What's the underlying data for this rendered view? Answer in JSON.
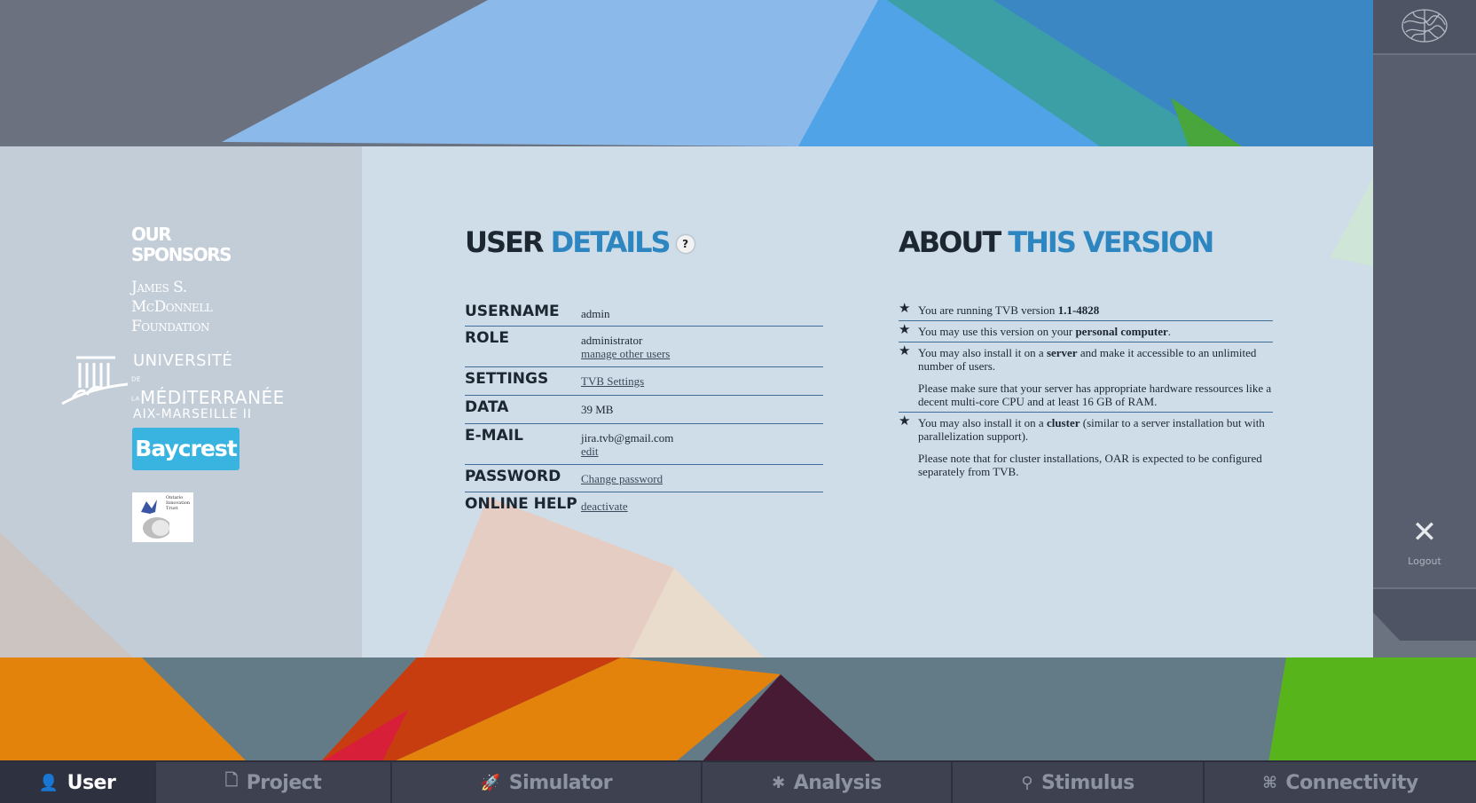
{
  "sponsors": {
    "title_line1": "OUR",
    "title_line2": "SPONSORS",
    "jsm_line1": "James S.",
    "jsm_line2": "McDonnell",
    "jsm_line3": "Foundation",
    "univ_line1": "UNIVERSITÉ",
    "univ_line2": "MÉDITERRANÉE",
    "univ_small": "DE LA",
    "univ_line3": "AIX-MARSEILLE II",
    "baycrest": "Baycrest",
    "oit_text": "Ontario Innovation Trust"
  },
  "user_details": {
    "title_a": "USER",
    "title_b": "DETAILS",
    "help": "?",
    "rows": {
      "username": {
        "label": "USERNAME",
        "value": "admin"
      },
      "role": {
        "label": "ROLE",
        "value": "administrator",
        "link": "manage other users"
      },
      "settings": {
        "label": "SETTINGS",
        "link": "TVB Settings"
      },
      "data": {
        "label": "DATA",
        "value": "39 MB"
      },
      "email": {
        "label": "E-MAIL",
        "value": "jira.tvb@gmail.com",
        "link": "edit"
      },
      "password": {
        "label": "PASSWORD",
        "link": "Change password"
      },
      "online_help": {
        "label": "ONLINE HELP",
        "link": "deactivate"
      }
    }
  },
  "about": {
    "title_a": "ABOUT",
    "title_b": "THIS VERSION",
    "item1_pre": "You are running TVB version ",
    "item1_bold": "1.1-4828",
    "item2_pre": "You may use this version on your ",
    "item2_bold": "personal computer",
    "item2_post": ".",
    "item3_pre": "You may also install it on a ",
    "item3_bold": "server",
    "item3_post": " and make it accessible to an unlimited number of users.",
    "item3_note": "Please make sure that your server has appropriate hardware ressources like a decent multi-core CPU and at least 16 GB of RAM.",
    "item4_pre": "You may also install it on a ",
    "item4_bold": "cluster",
    "item4_post": " (similar to a server installation but with parallelization support).",
    "item4_note": "Please note that for cluster installations, OAR is expected to be configured separately from TVB."
  },
  "rail": {
    "logout_label": "Logout",
    "logout_glyph": "✕"
  },
  "nav": {
    "items": [
      {
        "label": "User",
        "icon": "user-icon",
        "glyph": "👤"
      },
      {
        "label": "Project",
        "icon": "document-icon",
        "glyph": "🗋"
      },
      {
        "label": "Simulator",
        "icon": "rocket-icon",
        "glyph": "🚀"
      },
      {
        "label": "Analysis",
        "icon": "gear-icon",
        "glyph": "✱"
      },
      {
        "label": "Stimulus",
        "icon": "pin-icon",
        "glyph": "⚲"
      },
      {
        "label": "Connectivity",
        "icon": "connectivity-icon",
        "glyph": "⌘"
      }
    ],
    "active": "User"
  },
  "colors": {
    "accent_blue": "#2e86c1",
    "heading_dark": "#1d2732",
    "baycrest": "#39b4e0",
    "nav_bg": "#3e4250",
    "nav_active": "#2d3140"
  }
}
